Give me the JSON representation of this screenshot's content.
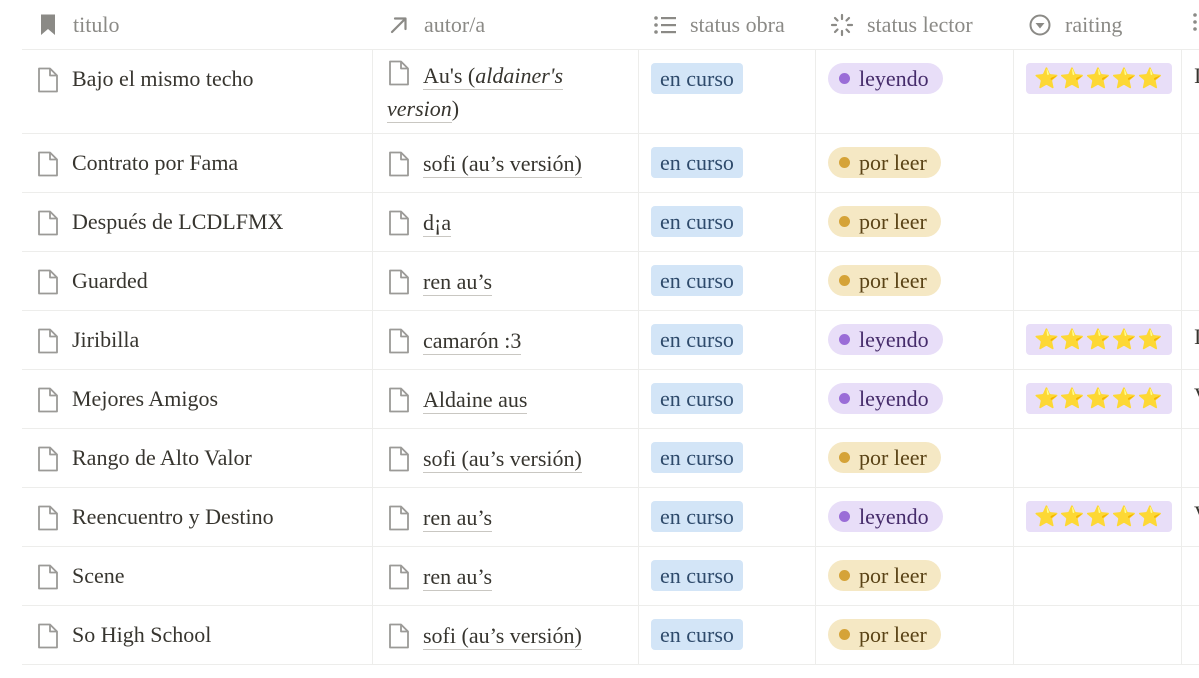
{
  "columns": {
    "titulo": "titulo",
    "autor": "autor/a",
    "status_obra": "status obra",
    "status_lector": "status lector",
    "raiting": "raiting"
  },
  "colors": {
    "en_curso_bg": "#d3e5f7",
    "leyendo_bg": "#e8def8",
    "leyendo_dot": "#9a6dd7",
    "por_leer_bg": "#f5e8c4",
    "por_leer_dot": "#d5a338"
  },
  "rows": [
    {
      "titulo": "Bajo el mismo techo",
      "autor_part1": "Au's (",
      "autor_part2": "aldainer's version",
      "autor_part3": ")",
      "status_obra": "en curso",
      "status_lector": "leyendo",
      "raiting": "⭐⭐⭐⭐⭐",
      "extra": "I"
    },
    {
      "titulo": "Contrato por Fama",
      "autor": "sofi (au’s versión)",
      "status_obra": "en curso",
      "status_lector": "por leer"
    },
    {
      "titulo": "Después de LCDLFMX",
      "autor": "d¡a",
      "status_obra": "en curso",
      "status_lector": "por leer"
    },
    {
      "titulo": "Guarded",
      "autor": "ren au’s",
      "status_obra": "en curso",
      "status_lector": "por leer"
    },
    {
      "titulo": "Jiribilla",
      "autor": "camarón :3",
      "status_obra": "en curso",
      "status_lector": "leyendo",
      "raiting": "⭐⭐⭐⭐⭐",
      "extra": "I"
    },
    {
      "titulo": "Mejores Amigos",
      "autor": "Aldaine aus",
      "status_obra": "en curso",
      "status_lector": "leyendo",
      "raiting": "⭐⭐⭐⭐⭐",
      "extra": "V"
    },
    {
      "titulo": "Rango de Alto Valor",
      "autor": "sofi (au’s versión)",
      "status_obra": "en curso",
      "status_lector": "por leer"
    },
    {
      "titulo": "Reencuentro y Destino",
      "autor": "ren au’s",
      "status_obra": "en curso",
      "status_lector": "leyendo",
      "raiting": "⭐⭐⭐⭐⭐",
      "extra": "V"
    },
    {
      "titulo": "Scene",
      "autor": "ren au’s",
      "status_obra": "en curso",
      "status_lector": "por leer"
    },
    {
      "titulo": "So High School",
      "autor": "sofi (au’s versión)",
      "status_obra": "en curso",
      "status_lector": "por leer"
    }
  ]
}
